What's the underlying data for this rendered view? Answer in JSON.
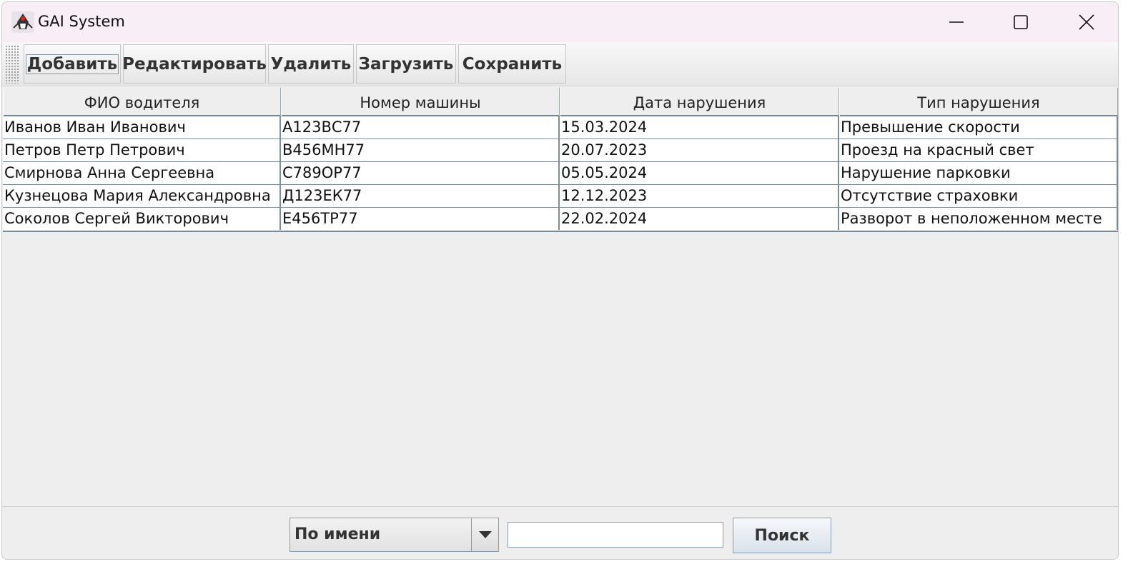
{
  "window": {
    "title": "GAI System",
    "icon": "java-duke-icon",
    "controls": [
      "minimize-icon",
      "maximize-icon",
      "close-icon"
    ]
  },
  "toolbar": {
    "buttons": [
      {
        "label": "Добавить",
        "focused": true
      },
      {
        "label": "Редактировать"
      },
      {
        "label": "Удалить"
      },
      {
        "label": "Загрузить"
      },
      {
        "label": "Сохранить"
      }
    ]
  },
  "table": {
    "columns": [
      "ФИО водителя",
      "Номер машины",
      "Дата нарушения",
      "Тип нарушения"
    ],
    "rows": [
      [
        "Иванов Иван Иванович",
        "А123ВС77",
        "15.03.2024",
        "Превышение скорости"
      ],
      [
        "Петров Петр Петрович",
        "В456МН77",
        "20.07.2023",
        "Проезд на красный свет"
      ],
      [
        "Смирнова Анна Сергеевна",
        "С789ОР77",
        "05.05.2024",
        "Нарушение парковки"
      ],
      [
        "Кузнецова Мария Александровна",
        "Д123ЕК77",
        "12.12.2023",
        "Отсутствие страховки"
      ],
      [
        "Соколов Сергей Викторович",
        "Е456ТР77",
        "22.02.2024",
        "Разворот в неположенном месте"
      ]
    ]
  },
  "search": {
    "mode_selected": "По имени",
    "query": "",
    "button_label": "Поиск"
  }
}
